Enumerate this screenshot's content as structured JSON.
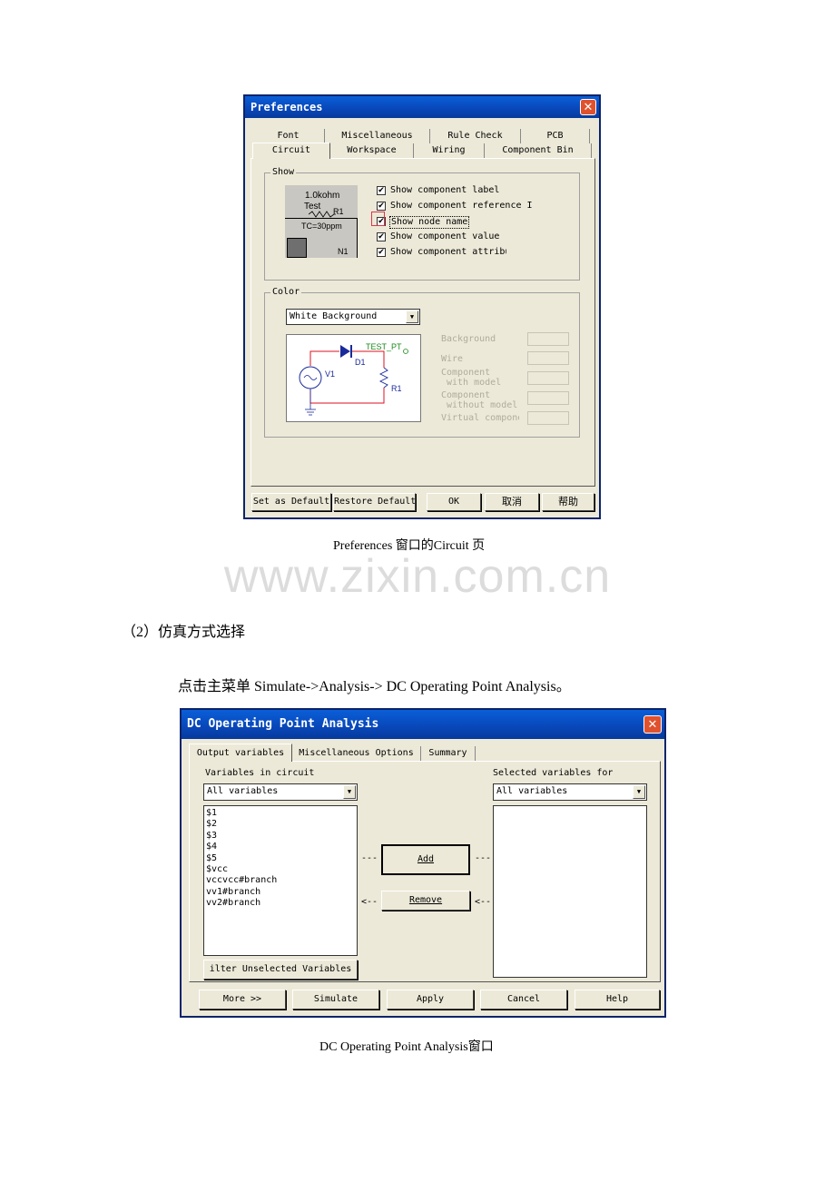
{
  "prefs": {
    "title": "Preferences",
    "close_glyph": "✕",
    "tabs_row1": [
      "Font",
      "Miscellaneous",
      "Rule Check",
      "PCB"
    ],
    "tabs_row2": [
      "Circuit",
      "Workspace",
      "Wiring",
      "Component Bin"
    ],
    "show_group": "Show",
    "preview": {
      "value": "1.0kohm",
      "test": "Test",
      "ref": "R1",
      "tc": "TC=30ppm",
      "node": "N1"
    },
    "checkboxes": [
      "Show component label",
      "Show component reference I",
      "Show node names",
      "Show component values",
      "Show component attribu"
    ],
    "check_glyph": "✔",
    "color_group": "Color",
    "color_scheme": "White Background",
    "schematic": {
      "test_point": "TEST_PT",
      "diode": "D1",
      "source": "V1",
      "resistor": "R1"
    },
    "color_labels": {
      "background": "Background",
      "wire": "Wire",
      "comp_model_1": "Component",
      "comp_model_2": "with model",
      "comp_nomodel_1": "Component",
      "comp_nomodel_2": "without model",
      "virtual": "Virtual compone"
    },
    "buttons": {
      "set_default": "Set as Default",
      "restore_default": "Restore Default",
      "ok": "OK",
      "cancel": "取消",
      "help": "帮助"
    }
  },
  "caption1": "Preferences 窗口的Circuit 页",
  "watermark": "www.zixin.com.cn",
  "section_heading": "（2）仿真方式选择",
  "instruction": "点击主菜单  Simulate->Analysis-> DC Operating Point Analysis。",
  "dcop": {
    "title": "DC Operating Point Analysis",
    "close_glyph": "✕",
    "tabs": [
      "Output variables",
      "Miscellaneous Options",
      "Summary"
    ],
    "vars_label": "Variables in circuit",
    "vars_filter": "All variables",
    "variables": [
      "$1",
      "$2",
      "$3",
      "$4",
      "$5",
      "$vcc",
      "vccvcc#branch",
      "vv1#branch",
      "vv2#branch"
    ],
    "selected_label": "Selected variables for",
    "selected_filter": "All variables",
    "add_button": "Add",
    "remove_button": "Remove",
    "add_arrow_left": "---",
    "add_arrow_right": "---",
    "remove_arrow_left": "<--",
    "remove_arrow_right": "<--",
    "filter_button": "ilter Unselected Variables",
    "buttons": {
      "more": "More >>",
      "simulate": "Simulate",
      "apply": "Apply",
      "cancel": "Cancel",
      "help": "Help"
    }
  },
  "caption2": "DC Operating Point Analysis窗口"
}
